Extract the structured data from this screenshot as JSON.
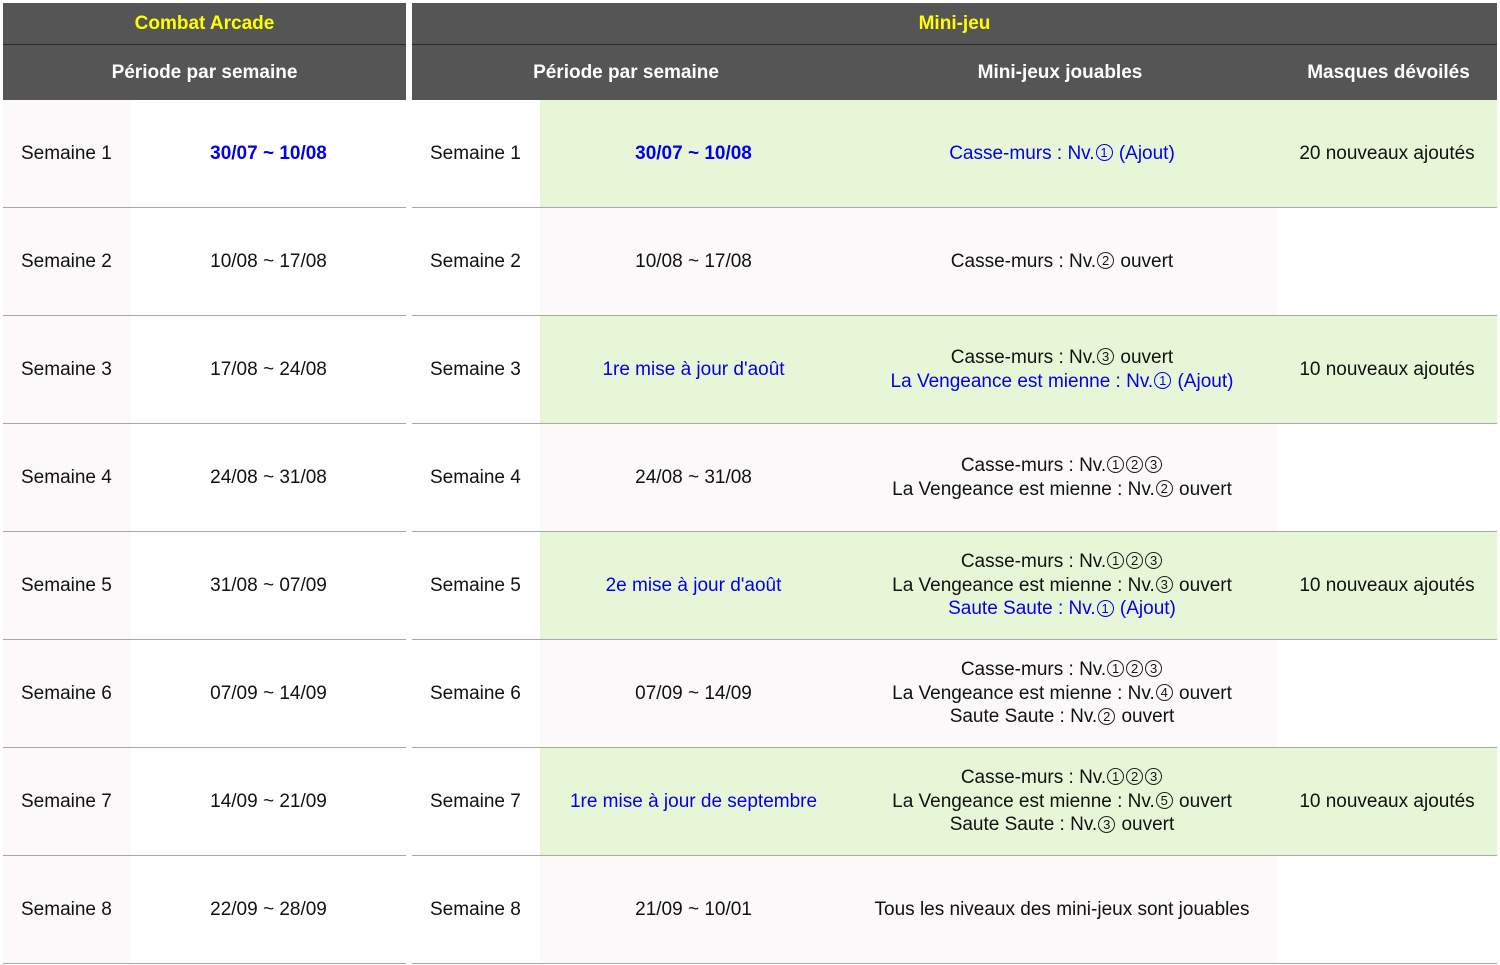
{
  "combat": {
    "title": "Combat Arcade",
    "period_header": "Période par semaine",
    "rows": [
      {
        "week": "Semaine 1",
        "date": "30/07 ~ 10/08"
      },
      {
        "week": "Semaine 2",
        "date": "10/08 ~ 17/08"
      },
      {
        "week": "Semaine 3",
        "date": "17/08 ~ 24/08"
      },
      {
        "week": "Semaine 4",
        "date": "24/08 ~ 31/08"
      },
      {
        "week": "Semaine 5",
        "date": "31/08 ~ 07/09"
      },
      {
        "week": "Semaine 6",
        "date": "07/09 ~ 14/09"
      },
      {
        "week": "Semaine 7",
        "date": "14/09 ~ 21/09"
      },
      {
        "week": "Semaine 8",
        "date": "22/09 ~ 28/09"
      }
    ]
  },
  "minijeu": {
    "title": "Mini-jeu",
    "headers": [
      "Période par semaine",
      "Mini-jeux jouables",
      "Masques dévoilés"
    ],
    "rows": [
      {
        "week": "Semaine 1",
        "date": "30/07 ~ 10/08",
        "masks": "20 nouveaux ajoutés",
        "games": [
          [
            {
              "t": "Casse-murs : Nv."
            },
            {
              "c": "1"
            },
            {
              "t": " (Ajout)"
            }
          ]
        ]
      },
      {
        "week": "Semaine 2",
        "date": "10/08 ~ 17/08",
        "masks": "",
        "games": [
          [
            {
              "t": "Casse-murs : Nv."
            },
            {
              "c": "2"
            },
            {
              "t": " ouvert"
            }
          ]
        ]
      },
      {
        "week": "Semaine 3",
        "date": "1re mise à jour d'août",
        "masks": "10 nouveaux ajoutés",
        "games": [
          [
            {
              "t": "Casse-murs : Nv."
            },
            {
              "c": "3"
            },
            {
              "t": " ouvert"
            }
          ],
          [
            {
              "t": "La Vengeance est mienne : Nv."
            },
            {
              "c": "1"
            },
            {
              "t": " (Ajout)"
            }
          ]
        ]
      },
      {
        "week": "Semaine 4",
        "date": "24/08 ~ 31/08",
        "masks": "",
        "games": [
          [
            {
              "t": "Casse-murs : Nv."
            },
            {
              "c": "1"
            },
            {
              "c": "2"
            },
            {
              "c": "3"
            }
          ],
          [
            {
              "t": "La Vengeance est mienne : Nv."
            },
            {
              "c": "2"
            },
            {
              "t": " ouvert"
            }
          ]
        ]
      },
      {
        "week": "Semaine 5",
        "date": "2e mise à jour d'août",
        "masks": "10 nouveaux ajoutés",
        "games": [
          [
            {
              "t": "Casse-murs : Nv."
            },
            {
              "c": "1"
            },
            {
              "c": "2"
            },
            {
              "c": "3"
            }
          ],
          [
            {
              "t": "La Vengeance est mienne : Nv."
            },
            {
              "c": "3"
            },
            {
              "t": " ouvert"
            }
          ],
          [
            {
              "t": "Saute Saute : Nv."
            },
            {
              "c": "1"
            },
            {
              "t": " (Ajout)"
            }
          ]
        ]
      },
      {
        "week": "Semaine 6",
        "date": "07/09 ~ 14/09",
        "masks": "",
        "games": [
          [
            {
              "t": "Casse-murs : Nv."
            },
            {
              "c": "1"
            },
            {
              "c": "2"
            },
            {
              "c": "3"
            }
          ],
          [
            {
              "t": "La Vengeance est mienne : Nv."
            },
            {
              "c": "4"
            },
            {
              "t": " ouvert"
            }
          ],
          [
            {
              "t": "Saute Saute : Nv."
            },
            {
              "c": "2"
            },
            {
              "t": " ouvert"
            }
          ]
        ]
      },
      {
        "week": "Semaine 7",
        "date": "1re mise à jour de septembre",
        "masks": "10 nouveaux ajoutés",
        "games": [
          [
            {
              "t": "Casse-murs : Nv."
            },
            {
              "c": "1"
            },
            {
              "c": "2"
            },
            {
              "c": "3"
            }
          ],
          [
            {
              "t": "La Vengeance est mienne : Nv."
            },
            {
              "c": "5"
            },
            {
              "t": " ouvert"
            }
          ],
          [
            {
              "t": "Saute Saute : Nv."
            },
            {
              "c": "3"
            },
            {
              "t": " ouvert"
            }
          ]
        ]
      },
      {
        "week": "Semaine 8",
        "date": "21/09 ~ 10/01",
        "masks": "",
        "games": [
          [
            {
              "t": "Tous les niveaux des mini-jeux sont jouables"
            }
          ]
        ]
      }
    ]
  },
  "colors": {
    "header_bg": "#555555",
    "title_text": "#ffff00",
    "header_text": "#ffffff",
    "highlight_bg": "#e8f6d8",
    "accent_blue": "#0000ee"
  }
}
